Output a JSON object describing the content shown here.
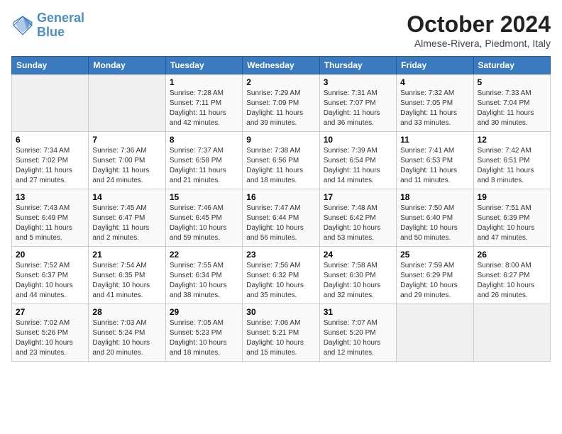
{
  "header": {
    "logo_line1": "General",
    "logo_line2": "Blue",
    "month_title": "October 2024",
    "location": "Almese-Rivera, Piedmont, Italy"
  },
  "weekdays": [
    "Sunday",
    "Monday",
    "Tuesday",
    "Wednesday",
    "Thursday",
    "Friday",
    "Saturday"
  ],
  "weeks": [
    [
      {
        "day": "",
        "info": ""
      },
      {
        "day": "",
        "info": ""
      },
      {
        "day": "1",
        "info": "Sunrise: 7:28 AM\nSunset: 7:11 PM\nDaylight: 11 hours and 42 minutes."
      },
      {
        "day": "2",
        "info": "Sunrise: 7:29 AM\nSunset: 7:09 PM\nDaylight: 11 hours and 39 minutes."
      },
      {
        "day": "3",
        "info": "Sunrise: 7:31 AM\nSunset: 7:07 PM\nDaylight: 11 hours and 36 minutes."
      },
      {
        "day": "4",
        "info": "Sunrise: 7:32 AM\nSunset: 7:05 PM\nDaylight: 11 hours and 33 minutes."
      },
      {
        "day": "5",
        "info": "Sunrise: 7:33 AM\nSunset: 7:04 PM\nDaylight: 11 hours and 30 minutes."
      }
    ],
    [
      {
        "day": "6",
        "info": "Sunrise: 7:34 AM\nSunset: 7:02 PM\nDaylight: 11 hours and 27 minutes."
      },
      {
        "day": "7",
        "info": "Sunrise: 7:36 AM\nSunset: 7:00 PM\nDaylight: 11 hours and 24 minutes."
      },
      {
        "day": "8",
        "info": "Sunrise: 7:37 AM\nSunset: 6:58 PM\nDaylight: 11 hours and 21 minutes."
      },
      {
        "day": "9",
        "info": "Sunrise: 7:38 AM\nSunset: 6:56 PM\nDaylight: 11 hours and 18 minutes."
      },
      {
        "day": "10",
        "info": "Sunrise: 7:39 AM\nSunset: 6:54 PM\nDaylight: 11 hours and 14 minutes."
      },
      {
        "day": "11",
        "info": "Sunrise: 7:41 AM\nSunset: 6:53 PM\nDaylight: 11 hours and 11 minutes."
      },
      {
        "day": "12",
        "info": "Sunrise: 7:42 AM\nSunset: 6:51 PM\nDaylight: 11 hours and 8 minutes."
      }
    ],
    [
      {
        "day": "13",
        "info": "Sunrise: 7:43 AM\nSunset: 6:49 PM\nDaylight: 11 hours and 5 minutes."
      },
      {
        "day": "14",
        "info": "Sunrise: 7:45 AM\nSunset: 6:47 PM\nDaylight: 11 hours and 2 minutes."
      },
      {
        "day": "15",
        "info": "Sunrise: 7:46 AM\nSunset: 6:45 PM\nDaylight: 10 hours and 59 minutes."
      },
      {
        "day": "16",
        "info": "Sunrise: 7:47 AM\nSunset: 6:44 PM\nDaylight: 10 hours and 56 minutes."
      },
      {
        "day": "17",
        "info": "Sunrise: 7:48 AM\nSunset: 6:42 PM\nDaylight: 10 hours and 53 minutes."
      },
      {
        "day": "18",
        "info": "Sunrise: 7:50 AM\nSunset: 6:40 PM\nDaylight: 10 hours and 50 minutes."
      },
      {
        "day": "19",
        "info": "Sunrise: 7:51 AM\nSunset: 6:39 PM\nDaylight: 10 hours and 47 minutes."
      }
    ],
    [
      {
        "day": "20",
        "info": "Sunrise: 7:52 AM\nSunset: 6:37 PM\nDaylight: 10 hours and 44 minutes."
      },
      {
        "day": "21",
        "info": "Sunrise: 7:54 AM\nSunset: 6:35 PM\nDaylight: 10 hours and 41 minutes."
      },
      {
        "day": "22",
        "info": "Sunrise: 7:55 AM\nSunset: 6:34 PM\nDaylight: 10 hours and 38 minutes."
      },
      {
        "day": "23",
        "info": "Sunrise: 7:56 AM\nSunset: 6:32 PM\nDaylight: 10 hours and 35 minutes."
      },
      {
        "day": "24",
        "info": "Sunrise: 7:58 AM\nSunset: 6:30 PM\nDaylight: 10 hours and 32 minutes."
      },
      {
        "day": "25",
        "info": "Sunrise: 7:59 AM\nSunset: 6:29 PM\nDaylight: 10 hours and 29 minutes."
      },
      {
        "day": "26",
        "info": "Sunrise: 8:00 AM\nSunset: 6:27 PM\nDaylight: 10 hours and 26 minutes."
      }
    ],
    [
      {
        "day": "27",
        "info": "Sunrise: 7:02 AM\nSunset: 5:26 PM\nDaylight: 10 hours and 23 minutes."
      },
      {
        "day": "28",
        "info": "Sunrise: 7:03 AM\nSunset: 5:24 PM\nDaylight: 10 hours and 20 minutes."
      },
      {
        "day": "29",
        "info": "Sunrise: 7:05 AM\nSunset: 5:23 PM\nDaylight: 10 hours and 18 minutes."
      },
      {
        "day": "30",
        "info": "Sunrise: 7:06 AM\nSunset: 5:21 PM\nDaylight: 10 hours and 15 minutes."
      },
      {
        "day": "31",
        "info": "Sunrise: 7:07 AM\nSunset: 5:20 PM\nDaylight: 10 hours and 12 minutes."
      },
      {
        "day": "",
        "info": ""
      },
      {
        "day": "",
        "info": ""
      }
    ]
  ]
}
